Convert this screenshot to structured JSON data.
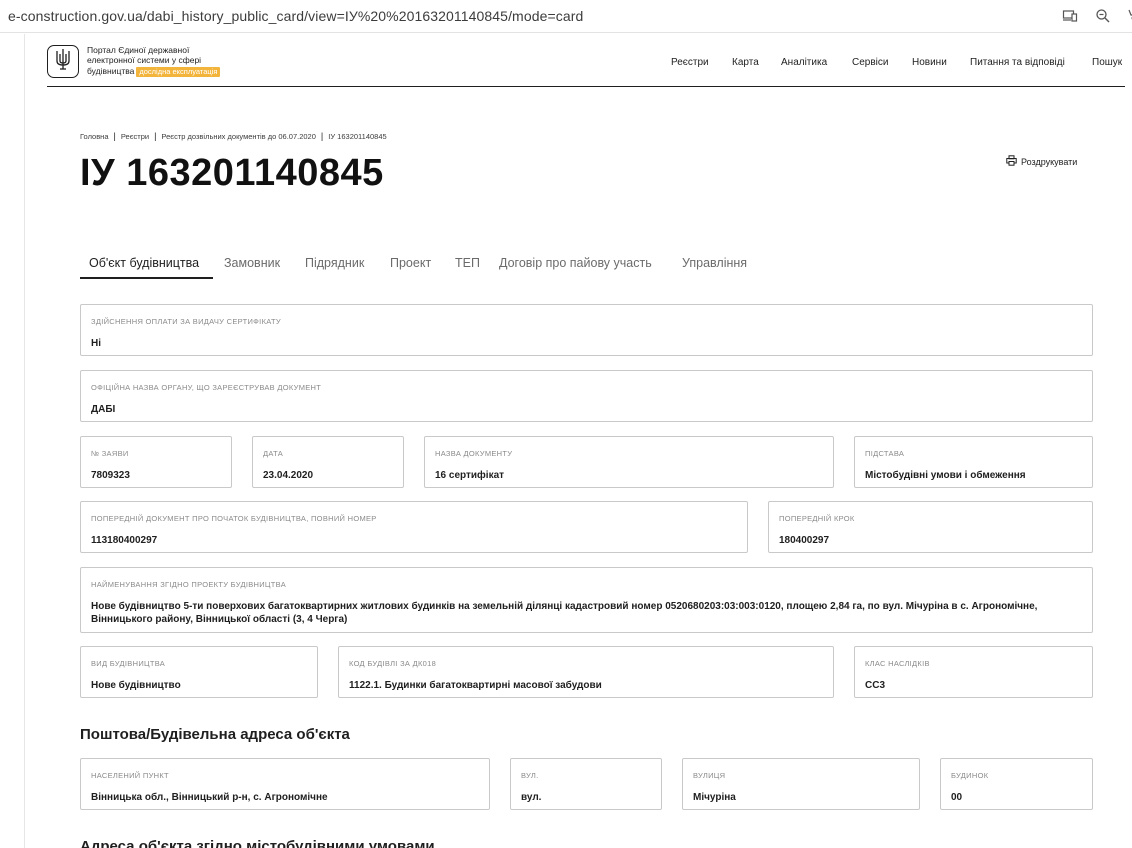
{
  "browser": {
    "url": "e-construction.gov.ua/dabi_history_public_card/view=ІУ%20%20163201140845/mode=card"
  },
  "header": {
    "portal_line1": "Портал Єдиної державної",
    "portal_line2": "електронної системи у сфері",
    "portal_line3": "будівництва",
    "beta_badge": "дослідна експлуатація",
    "nav": [
      "Реєстри",
      "Карта",
      "Аналітика",
      "Сервіси",
      "Новини",
      "Питання та відповіді",
      "Пошук"
    ]
  },
  "breadcrumb": [
    "Головна",
    "Реєстри",
    "Реєстр дозвільних документів до 06.07.2020",
    "ІУ 163201140845"
  ],
  "page_title": "ІУ 163201140845",
  "print_label": "Роздрукувати",
  "tabs": [
    "Об'єкт будівництва",
    "Замовник",
    "Підрядник",
    "Проект",
    "ТЕП",
    "Договір про пайову участь",
    "Управління"
  ],
  "fields": {
    "payment": {
      "label": "Здійснення оплати за видачу сертифікату",
      "value": "Ні"
    },
    "authority": {
      "label": "Офіційна назва органу, що зареєстрував документ",
      "value": "ДАБІ"
    },
    "app_no": {
      "label": "№ заяви",
      "value": "7809323"
    },
    "date": {
      "label": "Дата",
      "value": "23.04.2020"
    },
    "doc_name": {
      "label": "Назва документу",
      "value": "16 сертифікат"
    },
    "basis": {
      "label": "Підстава",
      "value": "Містобудівні умови і обмеження"
    },
    "prev_doc": {
      "label": "Попередній документ про початок будівництва, повний номер",
      "value": "113180400297"
    },
    "prev_step": {
      "label": "Попередній крок",
      "value": "180400297"
    },
    "project_name": {
      "label": "Найменування згідно проекту будівництва",
      "value": "Нове будівництво 5-ти поверхових багатоквартирних житлових будинків на земельній ділянці кадастровий номер 0520680203:03:003:0120, площею 2,84 га, по вул. Мічуріна в с. Агрономічне, Вінницького району, Вінницької області (3, 4 Черга)"
    },
    "constr_type": {
      "label": "Вид будівництва",
      "value": "Нове будівництво"
    },
    "building_code": {
      "label": "Код будівлі за ДК018",
      "value": "1122.1. Будинки багатоквартирні масової забудови"
    },
    "consequence_class": {
      "label": "Клас наслідків",
      "value": "СС3"
    }
  },
  "address_section": {
    "title": "Поштова/Будівельна адреса об'єкта",
    "settlement": {
      "label": "Населений пункт",
      "value": "Вінницька обл., Вінницький р-н, с. Агрономічне"
    },
    "street_type": {
      "label": "Вул.",
      "value": "вул."
    },
    "street": {
      "label": "Вулиця",
      "value": "Мічуріна"
    },
    "building": {
      "label": "Будинок",
      "value": "00"
    }
  },
  "next_section_title": "Адреса об'єкта згідно містобудівними умовами",
  "icons": [
    "devices-icon",
    "zoom-icon",
    "bookmark-icon",
    "trident-icon",
    "printer-icon"
  ]
}
